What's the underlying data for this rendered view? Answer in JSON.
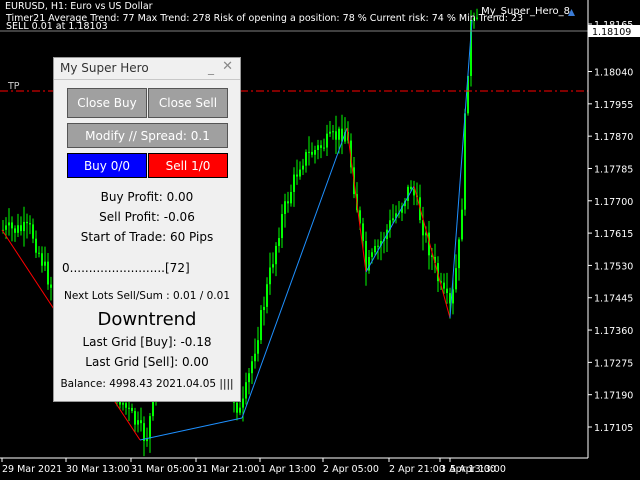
{
  "symbol_header": "EURUSD, H1:  Euro vs US Dollar",
  "info_line": "Timer21  Average Trend:  77 Max Trend: 278 Risk of opening a position: 78 % Current risk: 74 % Min Trend: 23",
  "sell_line": "SELL 0.01 at 1.18103",
  "tp_label": "TP",
  "ea_name": "My_Super_Hero_8",
  "price_axis": {
    "current_price": "1.18109",
    "labels": [
      "1.18165",
      "1.18040",
      "1.17955",
      "1.17870",
      "1.17785",
      "1.17700",
      "1.17615",
      "1.17530",
      "1.17445",
      "1.17360",
      "1.17275",
      "1.17190",
      "1.17105"
    ]
  },
  "time_axis": [
    "29 Mar 2021",
    "30 Mar 13:00",
    "31 Mar 05:00",
    "31 Mar 21:00",
    "1 Apr 13:00",
    "2 Apr 05:00",
    "2 Apr 21:00",
    "3 Apr 13:00",
    "5 Apr 13:00"
  ],
  "panel": {
    "title": "My Super Hero",
    "close_buy": "Close Buy",
    "close_sell": "Close Sell",
    "modify": "Modify // Spread: 0.1",
    "buy": "Buy 0/0",
    "sell": "Sell 1/0",
    "buy_profit": "Buy Profit: 0.00",
    "sell_profit": "Sell Profit: -0.06",
    "start_of_trade": "Start of Trade: 60 Pips",
    "progress": "0.........................[72]",
    "next_lots": "Next Lots Sell/Sum : 0.01 / 0.01",
    "trend": "Downtrend",
    "last_grid_buy": "Last Grid [Buy]: -0.18",
    "last_grid_sell": "Last Grid [Sell]: 0.00",
    "balance": "Balance: 4998.43 2021.04.05 ||||"
  },
  "colors": {
    "candle": "#00ff00",
    "current_price_line": "#808080",
    "tp_line": "#ff0000",
    "zigzag_up": "#1e90ff",
    "zigzag_down": "#ff0000",
    "button_blue": "#0000ff",
    "button_red": "#ff0000",
    "button_gray": "#a0a0a0"
  }
}
